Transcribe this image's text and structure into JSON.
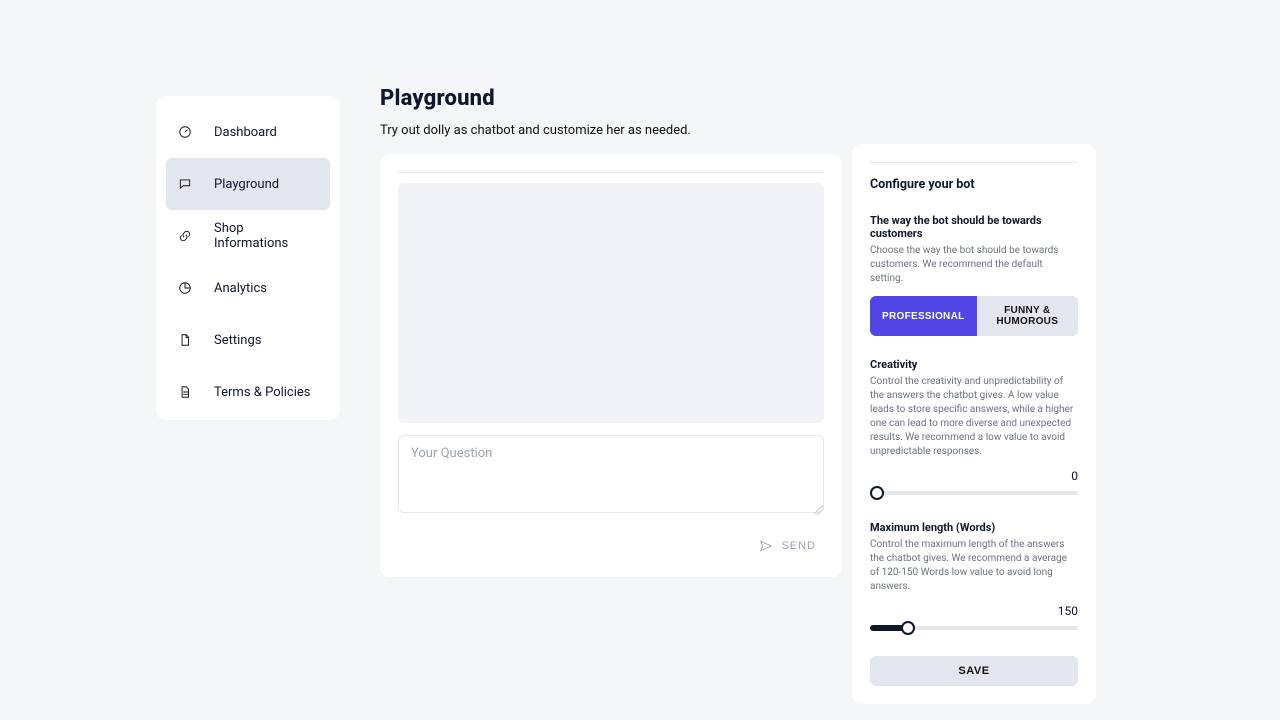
{
  "sidebar": {
    "items": [
      {
        "label": "Dashboard",
        "icon": "gauge-icon",
        "active": false
      },
      {
        "label": "Playground",
        "icon": "chat-icon",
        "active": true
      },
      {
        "label": "Shop Informations",
        "icon": "link-icon",
        "active": false
      },
      {
        "label": "Analytics",
        "icon": "pie-icon",
        "active": false
      },
      {
        "label": "Settings",
        "icon": "file-icon",
        "active": false
      },
      {
        "label": "Terms & Policies",
        "icon": "doc-icon",
        "active": false
      }
    ]
  },
  "header": {
    "title": "Playground",
    "subtitle": "Try out dolly as chatbot and customize her as needed."
  },
  "chat": {
    "placeholder": "Your Question",
    "send_label": "SEND"
  },
  "config": {
    "title": "Configure your bot",
    "tone": {
      "label": "The way the bot should be towards customers",
      "desc": "Choose the way the bot should be towards customers. We recommend the default setting.",
      "options": {
        "a": "PROFESSIONAL",
        "b": "FUNNY & HUMOROUS"
      }
    },
    "creativity": {
      "label": "Creativity",
      "desc": "Control the creativity and unpredictability of the answers the chatbot gives. A low value leads to store specific answers, while a higher one can lead to more diverse and unexpected results. We recommend a low value to avoid unpredictable responses.",
      "value": "0"
    },
    "maxlen": {
      "label": "Maximum length (Words)",
      "desc": "Control the maximum length of the answers the chatbot gives. We recommend a average of 120-150 Words low value to avoid long answers.",
      "value": "150"
    },
    "save_label": "SAVE"
  }
}
